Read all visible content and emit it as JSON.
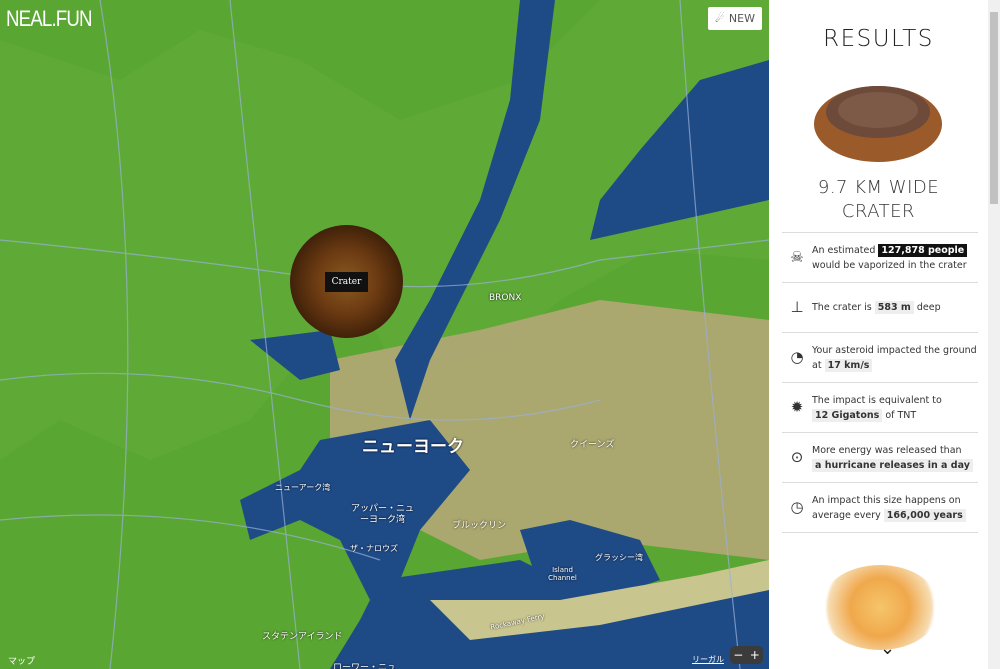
{
  "header": {
    "logo": "NEAL.FUN",
    "new_button": "NEW",
    "new_icon": "asteroid-icon"
  },
  "map": {
    "crater_label": "Crater",
    "labels": {
      "newyork": "ニューヨーク",
      "queens": "クイーンズ",
      "bronx": "BRONX",
      "brooklyn": "ブルックリン",
      "upper_bay": "アッパー・ニュ ーヨーク湾",
      "narrows": "ザ・ナロウズ",
      "newark_bay": "ニューアーク湾",
      "grassy_bay": "グラッシー湾",
      "island_channel": "Island Channel",
      "rockaway": "Rockaway Ferry",
      "staten": "スタテンアイランド",
      "lower_bay": "ローワー・ニュ"
    },
    "map_link": "マップ",
    "legal": "リーガル",
    "zoom_out": "−",
    "zoom_in": "+"
  },
  "results": {
    "title": "RESULTS",
    "crater_line1": "9.7 KM WIDE",
    "crater_line2": "CRATER",
    "stats": [
      {
        "icon": "skull-icon",
        "pre": "An estimated",
        "value": "127,878 people",
        "post": "would be vaporized in the crater"
      },
      {
        "icon": "depth-icon",
        "pre": "The crater is",
        "value": "583 m",
        "post": "deep"
      },
      {
        "icon": "speedometer-icon",
        "pre": "Your asteroid impacted the ground at",
        "value": "17 km/s",
        "post": ""
      },
      {
        "icon": "explosion-icon",
        "pre": "The impact is equivalent to",
        "value": "12 Gigatons",
        "post": "of TNT"
      },
      {
        "icon": "hurricane-icon",
        "pre": "More energy was released than",
        "value": "a hurricane releases in a day",
        "post": ""
      },
      {
        "icon": "clock-icon",
        "pre": "An impact this size happens on average every",
        "value": "166,000 years",
        "post": ""
      }
    ]
  },
  "colors": {
    "land": "#5aa632",
    "water": "#1e4a86",
    "highlight_dark": "#111111"
  }
}
